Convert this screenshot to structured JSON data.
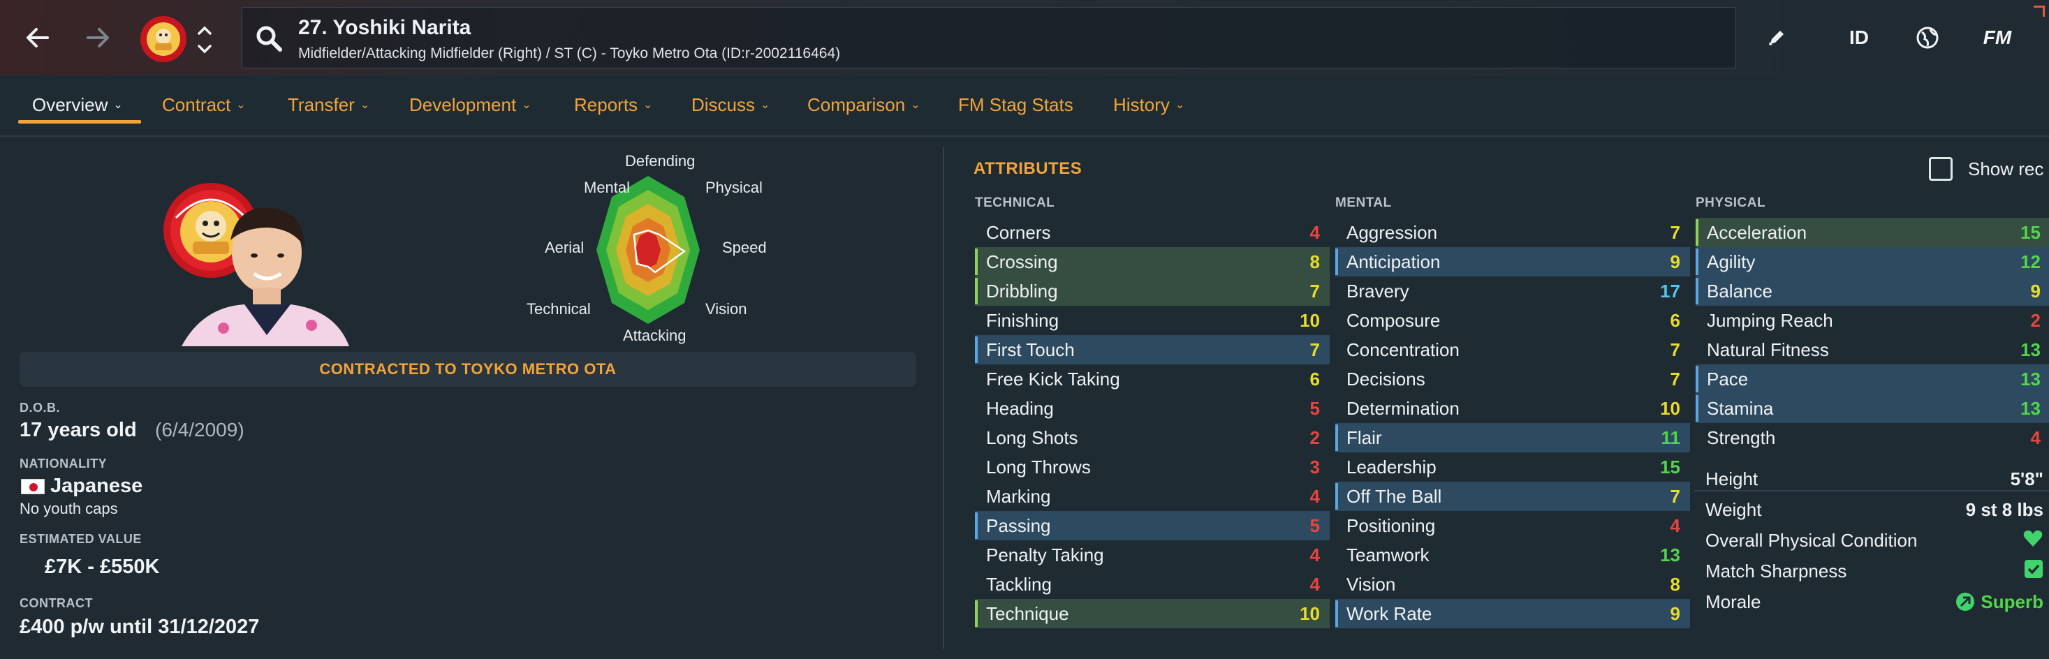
{
  "header": {
    "title": "27. Yoshiki Narita",
    "subtitle": "Midfielder/Attacking Midfielder (Right) / ST (C) - Toyko Metro Ota (ID:r-2002116464)",
    "id_label": "ID",
    "fm_label": "FM"
  },
  "tabs": [
    {
      "label": "Overview"
    },
    {
      "label": "Contract"
    },
    {
      "label": "Transfer"
    },
    {
      "label": "Development"
    },
    {
      "label": "Reports"
    },
    {
      "label": "Discuss"
    },
    {
      "label": "Comparison"
    },
    {
      "label": "FM Stag Stats"
    },
    {
      "label": "History"
    }
  ],
  "radar": {
    "labels": {
      "defending": "Defending",
      "physical": "Physical",
      "speed": "Speed",
      "vision": "Vision",
      "attacking": "Attacking",
      "technical": "Technical",
      "aerial": "Aerial",
      "mental": "Mental"
    }
  },
  "contract_banner": "CONTRACTED TO TOYKO METRO OTA",
  "info": {
    "dob_label": "D.O.B.",
    "age": "17 years old",
    "dob": "(6/4/2009)",
    "nationality_label": "NATIONALITY",
    "nationality": "Japanese",
    "youth_caps": "No youth caps",
    "value_label": "ESTIMATED VALUE",
    "value": "£7K - £550K",
    "contract_label": "CONTRACT",
    "contract": "£400 p/w until 31/12/2027"
  },
  "attributes": {
    "title": "ATTRIBUTES",
    "show_rec": "Show rec",
    "technical_head": "TECHNICAL",
    "mental_head": "MENTAL",
    "physical_head": "PHYSICAL",
    "technical": [
      {
        "name": "Corners",
        "value": "4",
        "hl": "",
        "color": "red"
      },
      {
        "name": "Crossing",
        "value": "8",
        "hl": "green",
        "color": "yellow"
      },
      {
        "name": "Dribbling",
        "value": "7",
        "hl": "green",
        "color": "yellow"
      },
      {
        "name": "Finishing",
        "value": "10",
        "hl": "",
        "color": "yellow"
      },
      {
        "name": "First Touch",
        "value": "7",
        "hl": "blue",
        "color": "yellow"
      },
      {
        "name": "Free Kick Taking",
        "value": "6",
        "hl": "",
        "color": "yellow"
      },
      {
        "name": "Heading",
        "value": "5",
        "hl": "",
        "color": "red"
      },
      {
        "name": "Long Shots",
        "value": "2",
        "hl": "",
        "color": "red"
      },
      {
        "name": "Long Throws",
        "value": "3",
        "hl": "",
        "color": "red"
      },
      {
        "name": "Marking",
        "value": "4",
        "hl": "",
        "color": "red"
      },
      {
        "name": "Passing",
        "value": "5",
        "hl": "blue",
        "color": "red"
      },
      {
        "name": "Penalty Taking",
        "value": "4",
        "hl": "",
        "color": "red"
      },
      {
        "name": "Tackling",
        "value": "4",
        "hl": "",
        "color": "red"
      },
      {
        "name": "Technique",
        "value": "10",
        "hl": "green",
        "color": "yellow"
      }
    ],
    "mental": [
      {
        "name": "Aggression",
        "value": "7",
        "hl": "",
        "color": "yellow"
      },
      {
        "name": "Anticipation",
        "value": "9",
        "hl": "blue",
        "color": "yellow"
      },
      {
        "name": "Bravery",
        "value": "17",
        "hl": "",
        "color": "cyan"
      },
      {
        "name": "Composure",
        "value": "6",
        "hl": "",
        "color": "yellow"
      },
      {
        "name": "Concentration",
        "value": "7",
        "hl": "",
        "color": "yellow"
      },
      {
        "name": "Decisions",
        "value": "7",
        "hl": "",
        "color": "yellow"
      },
      {
        "name": "Determination",
        "value": "10",
        "hl": "",
        "color": "yellow"
      },
      {
        "name": "Flair",
        "value": "11",
        "hl": "blue",
        "color": "green"
      },
      {
        "name": "Leadership",
        "value": "15",
        "hl": "",
        "color": "green"
      },
      {
        "name": "Off The Ball",
        "value": "7",
        "hl": "blue",
        "color": "yellow"
      },
      {
        "name": "Positioning",
        "value": "4",
        "hl": "",
        "color": "red"
      },
      {
        "name": "Teamwork",
        "value": "13",
        "hl": "",
        "color": "green"
      },
      {
        "name": "Vision",
        "value": "8",
        "hl": "",
        "color": "yellow"
      },
      {
        "name": "Work Rate",
        "value": "9",
        "hl": "blue",
        "color": "yellow"
      }
    ],
    "physical": [
      {
        "name": "Acceleration",
        "value": "15",
        "hl": "green",
        "color": "green"
      },
      {
        "name": "Agility",
        "value": "12",
        "hl": "blue",
        "color": "green"
      },
      {
        "name": "Balance",
        "value": "9",
        "hl": "blue",
        "color": "yellow"
      },
      {
        "name": "Jumping Reach",
        "value": "2",
        "hl": "",
        "color": "red"
      },
      {
        "name": "Natural Fitness",
        "value": "13",
        "hl": "",
        "color": "green"
      },
      {
        "name": "Pace",
        "value": "13",
        "hl": "blue",
        "color": "green"
      },
      {
        "name": "Stamina",
        "value": "13",
        "hl": "blue",
        "color": "green"
      },
      {
        "name": "Strength",
        "value": "4",
        "hl": "",
        "color": "red"
      }
    ],
    "physical_extra": {
      "height_label": "Height",
      "height": "5'8\"",
      "weight_label": "Weight",
      "weight": "9 st 8 lbs",
      "condition_label": "Overall Physical Condition",
      "sharpness_label": "Match Sharpness",
      "morale_label": "Morale",
      "morale": "Superb"
    }
  },
  "colors": {
    "accent": "#f2a43a",
    "red": "#e8453c",
    "yellow": "#e9dc2a",
    "green": "#52d64a",
    "cyan": "#54c6e8"
  }
}
